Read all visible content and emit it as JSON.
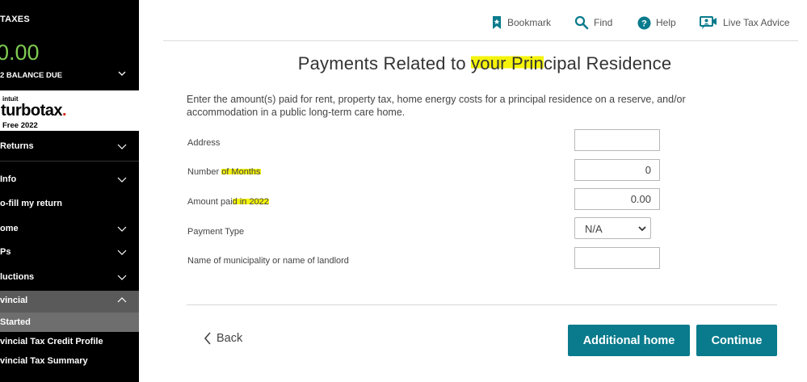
{
  "sidebar": {
    "taxes_label": "TAXES",
    "amount": "0.00",
    "balance_label": "2 BALANCE DUE",
    "logo": {
      "intuit": "intuit",
      "brand": "turbotax",
      "dot": ".",
      "edition": "Free 2022"
    },
    "nav": [
      {
        "label": "Returns",
        "has_chevron": true,
        "expanded": false
      },
      {
        "label": "Info",
        "has_chevron": true,
        "expanded": false
      },
      {
        "label": "o-fill my return",
        "has_chevron": false
      },
      {
        "label": "ome",
        "has_chevron": true,
        "expanded": false
      },
      {
        "label": "Ps",
        "has_chevron": true,
        "expanded": false
      },
      {
        "label": "luctions",
        "has_chevron": true,
        "expanded": false
      },
      {
        "label": "vincial",
        "has_chevron": true,
        "expanded": true
      }
    ],
    "sub_items": [
      {
        "label": "Started",
        "active": true
      },
      {
        "label": "vincial Tax Credit Profile",
        "active": false
      },
      {
        "label": "vincial Tax Summary",
        "active": false
      }
    ]
  },
  "toolbar": {
    "bookmark": "Bookmark",
    "find": "Find",
    "help": "Help",
    "live": "Live Tax Advice"
  },
  "page": {
    "title_part1": "Payments Related to ",
    "title_hl1": "your Prin",
    "title_part2": "cipal Residence",
    "intro": "Enter the amount(s) paid for rent, property tax, home energy costs for a principal residence on a reserve, and/or accommodation in a public long-term care home."
  },
  "form": {
    "address": {
      "label": "Address",
      "value": ""
    },
    "months": {
      "label_pre": "Number ",
      "label_hl": "of Months",
      "value": "0"
    },
    "amount": {
      "label_pre": "Amount pai",
      "label_hl": "d in 2022",
      "value": "0.00"
    },
    "payment_type": {
      "label": "Payment Type",
      "value": "N/A"
    },
    "municipality": {
      "label": "Name of municipality or name of landlord",
      "value": ""
    }
  },
  "buttons": {
    "back": "Back",
    "additional_home": "Additional home",
    "continue": "Continue"
  },
  "colors": {
    "accent": "#097b8c",
    "amount_green": "#7ecb52",
    "highlight": "#f4f30b",
    "sidebar_bg": "#000000"
  }
}
